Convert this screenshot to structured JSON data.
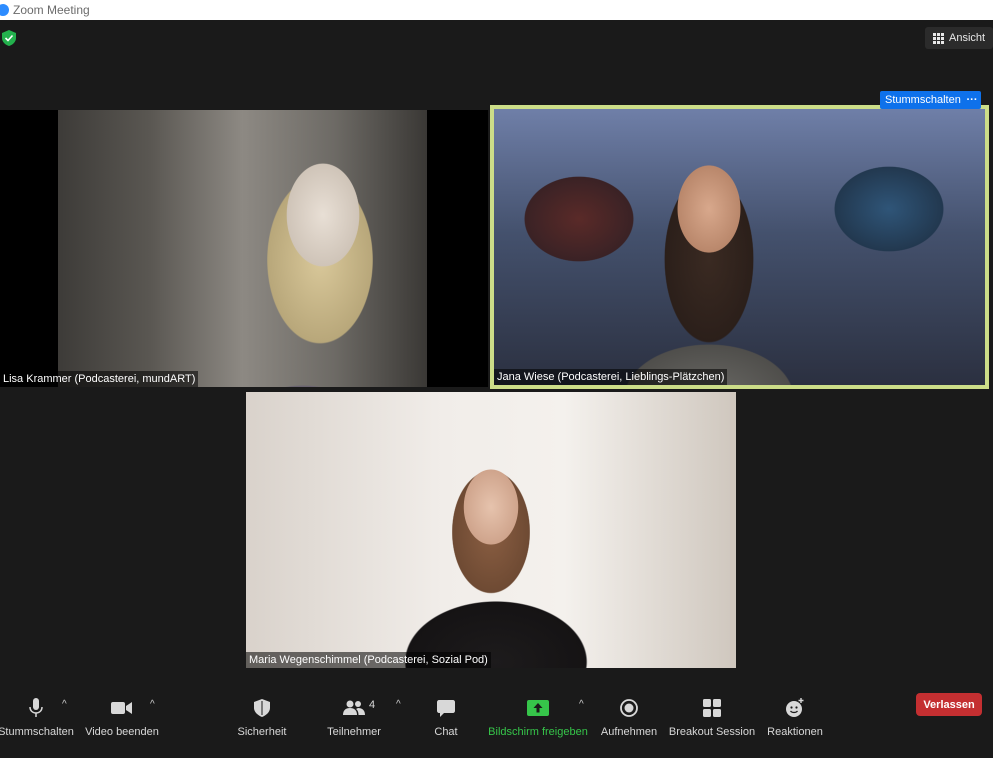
{
  "window": {
    "title": "Zoom Meeting"
  },
  "header": {
    "view_label": "Ansicht"
  },
  "participants": [
    {
      "name": "Lisa Krammer (Podcasterei, mundART)"
    },
    {
      "name": "Jana Wiese (Podcasterei, Lieblings-Plätzchen)",
      "mute_label": "Stummschalten",
      "more_label": "···"
    },
    {
      "name": "Maria Wegenschimmel (Podcasterei, Sozial Pod)"
    }
  ],
  "toolbar": {
    "mute": "Stummschalten",
    "video": "Video beenden",
    "security": "Sicherheit",
    "participants": "Teilnehmer",
    "participants_count": "4",
    "chat": "Chat",
    "share": "Bildschirm freigeben",
    "record": "Aufnehmen",
    "breakout": "Breakout Session",
    "reactions": "Reaktionen",
    "leave": "Verlassen"
  },
  "colors": {
    "accent": "#0e71eb",
    "share_green": "#36c54a",
    "leave_red": "#c42f31",
    "active_speaker_border": "#ccdd88"
  }
}
